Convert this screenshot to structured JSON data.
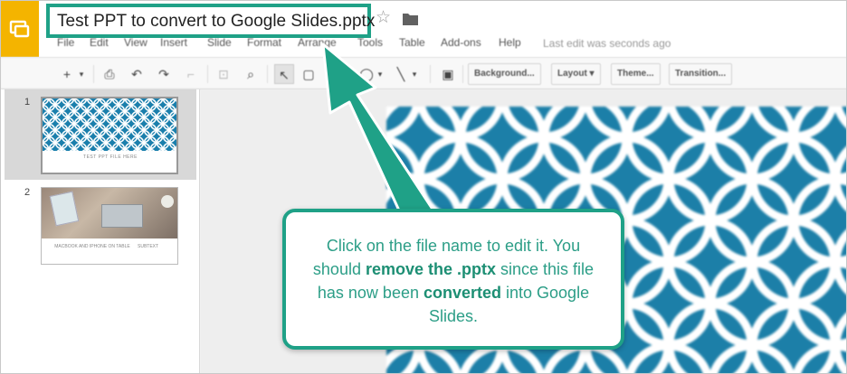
{
  "document": {
    "title": "Test PPT to convert to Google Slides.pptx"
  },
  "menu": {
    "items": [
      "File",
      "Edit",
      "View",
      "Insert",
      "Slide",
      "Format",
      "Arrange",
      "Tools",
      "Table",
      "Add-ons",
      "Help"
    ],
    "last_edit": "Last edit was seconds ago"
  },
  "toolbar": {
    "background_label": "Background...",
    "layout_label": "Layout",
    "theme_label": "Theme...",
    "transition_label": "Transition..."
  },
  "slides": [
    {
      "number": "1",
      "caption": "TEST PPT FILE HERE"
    },
    {
      "number": "2",
      "caption": "MACBOOK AND IPHONE ON TABLE",
      "caption2": "SUBTEXT"
    }
  ],
  "callout": {
    "text_part1": "Click on the file name to edit it. You should ",
    "bold1": "remove the .pptx",
    "text_part2": " since this file has now been ",
    "bold2": "converted",
    "text_part3": " into Google Slides."
  },
  "colors": {
    "accent": "#1fa187",
    "app_logo": "#f4b400",
    "slide_pattern": "#1c7fa8"
  },
  "icons": {
    "app": "slides-logo-icon",
    "star": "star-icon",
    "folder": "folder-icon"
  }
}
